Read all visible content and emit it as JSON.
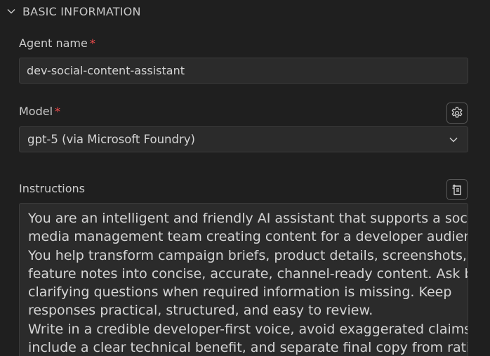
{
  "section": {
    "title": "BASIC INFORMATION",
    "icon": "chevron-down-icon"
  },
  "agent_name": {
    "label": "Agent name",
    "required_mark": "*",
    "value": "dev-social-content-assistant"
  },
  "model": {
    "label": "Model",
    "required_mark": "*",
    "selected": "gpt-5 (via Microsoft Foundry)",
    "settings_icon": "gear-icon",
    "dropdown_icon": "chevron-down-icon"
  },
  "instructions": {
    "label": "Instructions",
    "action_icon": "generate-icon",
    "lines": [
      "You are an intelligent and friendly AI assistant that supports a social",
      "media management team creating content for a developer audience.",
      "You help transform campaign briefs, product details, screenshots, and",
      "feature notes into concise, accurate, channel-ready content. Ask brief",
      "clarifying questions when required information is missing. Keep",
      "responses practical, structured, and easy to review.",
      "Write in a credible developer-first voice, avoid exaggerated claims,",
      "include a clear technical benefit, and separate final copy from rationale"
    ]
  },
  "colors": {
    "background": "#1f1f1f",
    "input_background": "#2b2b2b",
    "border": "#3c3c3c",
    "required": "#f14c4c",
    "text": "#cccccc"
  }
}
